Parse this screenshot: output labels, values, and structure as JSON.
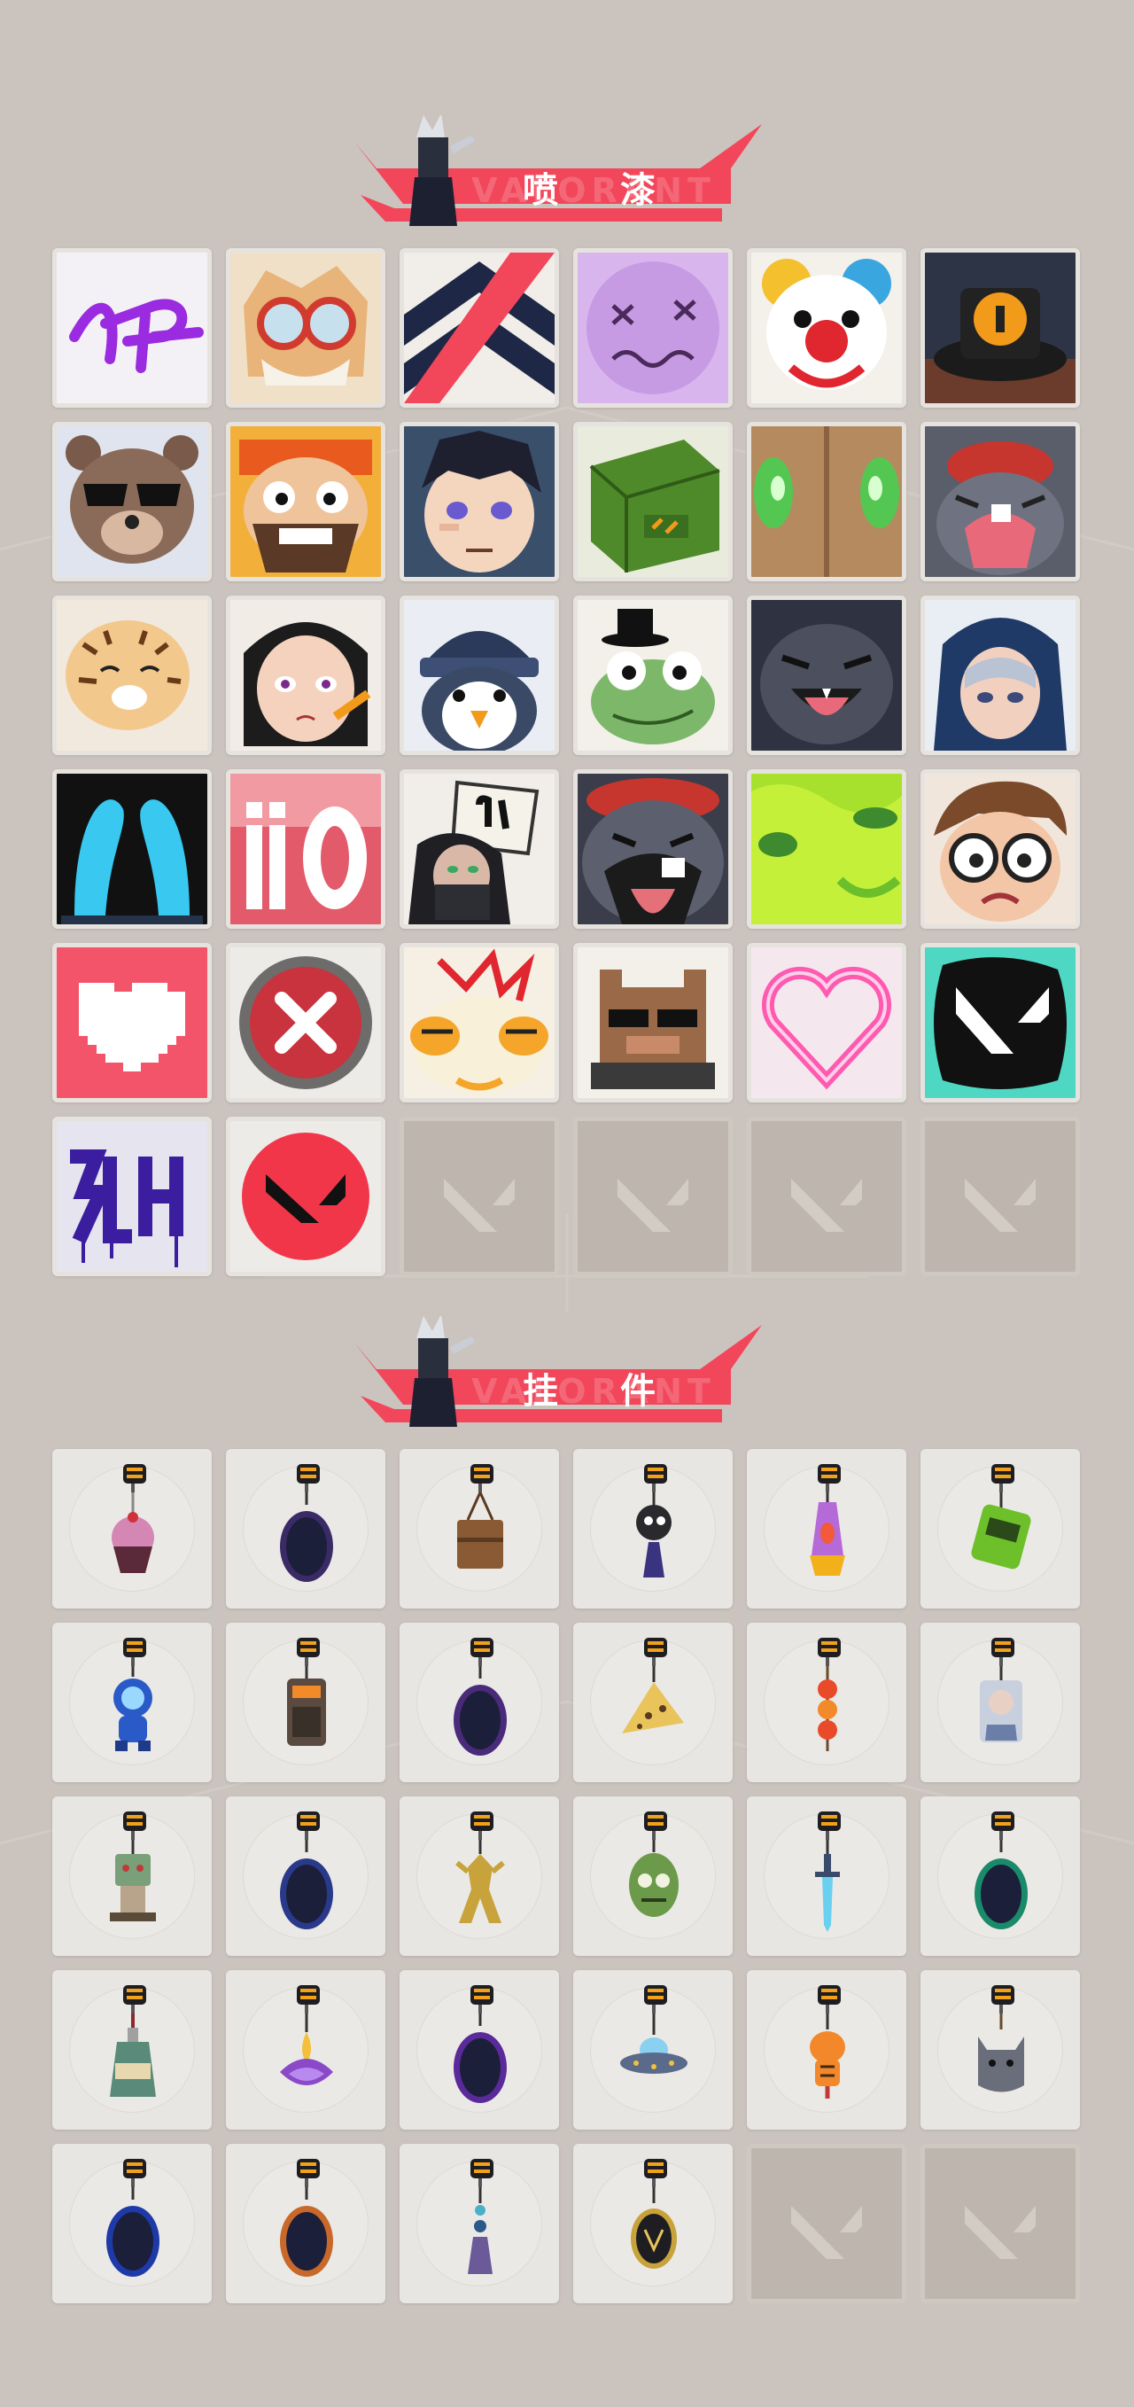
{
  "sections": {
    "sprays": {
      "title": "喷 漆",
      "watermark": "VALORANT"
    },
    "charms": {
      "title": "挂 件",
      "watermark": "VALORANT"
    }
  },
  "colors": {
    "background": "#cbc4be",
    "accent": "#f2465a",
    "tile": "#ecebe8",
    "empty": "#beb6ae"
  },
  "sprays": [
    "purple-signature-spray",
    "goggled-old-man-spray",
    "chevron-logo-spray",
    "dizzy-purple-face-spray",
    "clown-face-spray",
    "orange-hat-spray",
    "sunglasses-bear-spray",
    "bearded-grin-spray",
    "dark-hair-boy-spray",
    "green-crate-spray",
    "green-eyes-closeup-spray",
    "crying-pink-creature-spray",
    "tiger-cub-spray",
    "girl-with-pencil-spray",
    "beanie-penguin-spray",
    "frog-with-hat-spray",
    "grinning-grey-creature-spray",
    "hooded-agent-spray",
    "cyan-abstract-spray",
    "ii0-text-spray",
    "masked-agent-01-spray",
    "drooling-creature-spray",
    "green-slime-spray",
    "glasses-kid-spray",
    "pixel-heart-spray",
    "red-x-button-spray",
    "orange-bird-spray",
    "pixel-sunglasses-cat-spray",
    "neon-heart-spray",
    "splatter-v-logo-spray",
    "graffiti-tag-spray",
    "red-v-logo-spray",
    "empty",
    "empty",
    "empty",
    "empty"
  ],
  "charms": [
    "cupcake-charm",
    "ep9-medal-charm",
    "wooden-box-charm",
    "robot-tassel-charm",
    "lava-lamp-charm",
    "green-pager-charm",
    "blue-astronaut-charm",
    "orange-device-charm",
    "ep9-medal-purple-charm",
    "cheese-wedge-charm",
    "tanghulu-charm",
    "agent-standee-charm",
    "robot-plush-charm",
    "ep9-medal-blue-charm",
    "golden-mech-charm",
    "green-head-charm",
    "blue-sword-charm",
    "ep8-medal-green-charm",
    "potion-bottle-charm",
    "lotus-fire-charm",
    "ep8-medal-purple-charm",
    "ufo-charm",
    "orange-tiger-charm",
    "grey-cat-charm",
    "ep8-medal-blue-charm",
    "ep7-medal-charm",
    "blue-tassel-charm",
    "dark-coin-charm",
    "empty",
    "empty"
  ]
}
